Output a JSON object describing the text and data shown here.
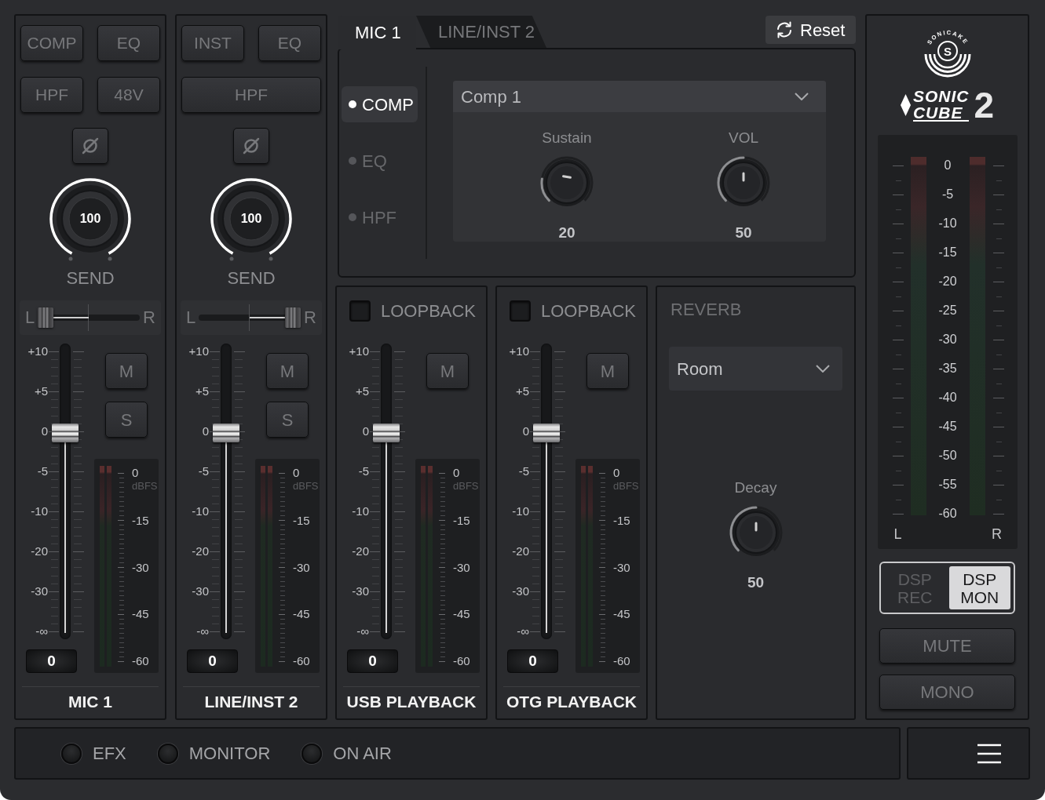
{
  "channel_strips": [
    {
      "kind": "input",
      "name": "MIC 1",
      "buttons": [
        {
          "label": "COMP",
          "on": false
        },
        {
          "label": "EQ",
          "on": false
        },
        {
          "label": "HPF",
          "on": false
        },
        {
          "label": "48V",
          "on": false
        }
      ],
      "phase": {
        "on": false
      },
      "send": {
        "label": "SEND",
        "value": "100",
        "level": 1
      },
      "pan": {
        "left": "L",
        "right": "R",
        "level": 0
      },
      "fader": {
        "scale": [
          "+10",
          "+5",
          "0",
          "-5",
          "-10",
          "-20",
          "-30",
          "-∞"
        ],
        "level": 0.71,
        "value": "0"
      },
      "mute": {
        "label": "M",
        "on": false
      },
      "solo": {
        "label": "S",
        "on": false
      },
      "meter": {
        "scale": [
          "0",
          "-15",
          "-30",
          "-45",
          "-60"
        ],
        "unit": "dBFS"
      }
    },
    {
      "kind": "input",
      "name": "LINE/INST 2",
      "buttons": [
        {
          "label": "INST",
          "on": false
        },
        {
          "label": "EQ",
          "on": false
        },
        {
          "label": "HPF",
          "on": false
        }
      ],
      "phase": {
        "on": false
      },
      "send": {
        "label": "SEND",
        "value": "100",
        "level": 1
      },
      "pan": {
        "left": "L",
        "right": "R",
        "level": 1
      },
      "fader": {
        "scale": [
          "+10",
          "+5",
          "0",
          "-5",
          "-10",
          "-20",
          "-30",
          "-∞"
        ],
        "level": 0.71,
        "value": "0"
      },
      "mute": {
        "label": "M",
        "on": false
      },
      "solo": {
        "label": "S",
        "on": false
      },
      "meter": {
        "scale": [
          "0",
          "-15",
          "-30",
          "-45",
          "-60"
        ],
        "unit": "dBFS"
      }
    },
    {
      "kind": "playback",
      "name": "USB PLAYBACK",
      "loopback": {
        "label": "LOOPBACK",
        "checked": false
      },
      "fader": {
        "scale": [
          "+10",
          "+5",
          "0",
          "-5",
          "-10",
          "-20",
          "-30",
          "-∞"
        ],
        "level": 0.71,
        "value": "0"
      },
      "mute": {
        "label": "M",
        "on": false
      },
      "meter": {
        "scale": [
          "0",
          "-15",
          "-30",
          "-45",
          "-60"
        ],
        "unit": "dBFS"
      }
    },
    {
      "kind": "playback",
      "name": "OTG PLAYBACK",
      "loopback": {
        "label": "LOOPBACK",
        "checked": false
      },
      "fader": {
        "scale": [
          "+10",
          "+5",
          "0",
          "-5",
          "-10",
          "-20",
          "-30",
          "-∞"
        ],
        "level": 0.71,
        "value": "0"
      },
      "mute": {
        "label": "M",
        "on": false
      },
      "meter": {
        "scale": [
          "0",
          "-15",
          "-30",
          "-45",
          "-60"
        ],
        "unit": "dBFS"
      }
    }
  ],
  "effects_panel": {
    "tabs": [
      {
        "label": "MIC 1",
        "selected": true
      },
      {
        "label": "LINE/INST 2",
        "selected": false
      }
    ],
    "reset_button": "Reset",
    "effects": [
      {
        "label": "COMP",
        "selected": true
      },
      {
        "label": "EQ",
        "selected": false
      },
      {
        "label": "HPF",
        "selected": false
      }
    ],
    "preset": "Comp 1",
    "knobs": [
      {
        "label": "Sustain",
        "value": "20",
        "level": 0.2
      },
      {
        "label": "VOL",
        "value": "50",
        "level": 0.5
      }
    ]
  },
  "reverb": {
    "title": "REVERB",
    "preset": "Room",
    "knob": {
      "label": "Decay",
      "value": "50",
      "level": 0.5
    }
  },
  "master": {
    "logo": {
      "ring_text": "SONICAKE",
      "letter": "S",
      "line_1": "SONIC",
      "line_2": "CUBE",
      "numeral": "2"
    },
    "meter": {
      "scale": [
        "0",
        "-5",
        "-10",
        "-15",
        "-20",
        "-25",
        "-30",
        "-35",
        "-40",
        "-45",
        "-50",
        "-55",
        "-60"
      ],
      "left": "L",
      "right": "R"
    },
    "modes": [
      {
        "label": "DSP REC",
        "selected": false
      },
      {
        "label": "DSP MON",
        "selected": true
      }
    ],
    "buttons": [
      {
        "label": "MUTE",
        "on": false
      },
      {
        "label": "MONO",
        "on": false
      }
    ]
  },
  "status_bar": {
    "indicators": [
      {
        "label": "EFX",
        "on": false
      },
      {
        "label": "MONITOR",
        "on": false
      },
      {
        "label": "ON AIR",
        "on": false
      }
    ]
  }
}
